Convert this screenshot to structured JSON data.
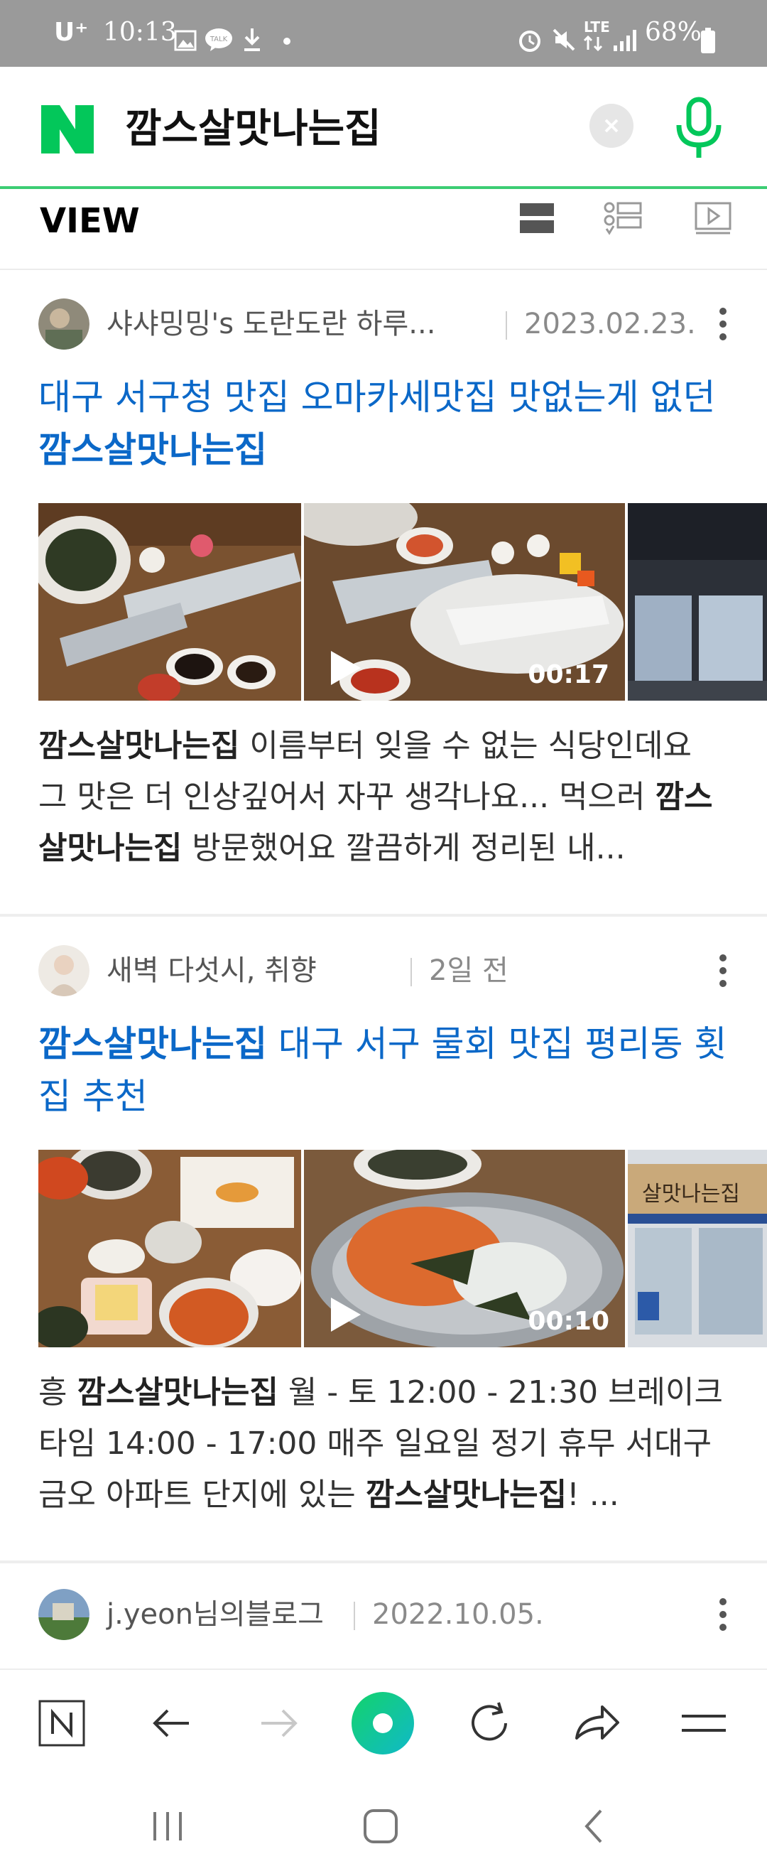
{
  "status_bar": {
    "carrier": "U⁺",
    "time": "10:13",
    "talk_label": "TALK",
    "network": "LTE",
    "battery": "68%"
  },
  "search": {
    "logo": "N",
    "query": "깜스살맛나는집"
  },
  "view": {
    "title": "VIEW"
  },
  "posts": [
    {
      "author": "샤샤밍밍's 도란도란 하루...",
      "date": "2023.02.23.",
      "title_plain": "대구 서구청 맛집 오마카세맛집 맛없는게 없던 ",
      "title_bold": "깜스살맛나는집",
      "video_duration": "00:17",
      "desc_bold1": "깜스살맛나는집",
      "desc_text1": " 이름부터 잊을 수 없는 식당인데요 그 맛은 더 인상깊어서 자꾸 생각나요... 먹으러 ",
      "desc_bold2": "깜스살맛나는집",
      "desc_text2": " 방문했어요 깔끔하게 정리된 내..."
    },
    {
      "author": "새벽 다섯시, 취향",
      "date": "2일 전",
      "title_bold": "깜스살맛나는집",
      "title_plain": " 대구 서구 물회 맛집 평리동 횟집 추천",
      "video_duration": "00:10",
      "desc_text0": "흥 ",
      "desc_bold1": "깜스살맛나는집",
      "desc_text1": " 월 - 토 12:00 - 21:30 브레이크 타임 14:00 - 17:00 매주 일요일 정기 휴무 서대구 금오 아파트 단지에 있는 ",
      "desc_bold2": "깜스살맛나는집",
      "desc_text2": "! ...",
      "sign_text": "살맛나는집"
    },
    {
      "author": "j.yeon님의블로그",
      "date": "2022.10.05."
    }
  ],
  "colors": {
    "naver_green": "#03c75a",
    "link_blue": "#0b68c8",
    "divider": "#3ccd73"
  },
  "icons": [
    "n-home-icon",
    "back-arrow-icon",
    "forward-arrow-icon",
    "green-dot-icon",
    "refresh-icon",
    "share-icon",
    "menu-icon"
  ]
}
